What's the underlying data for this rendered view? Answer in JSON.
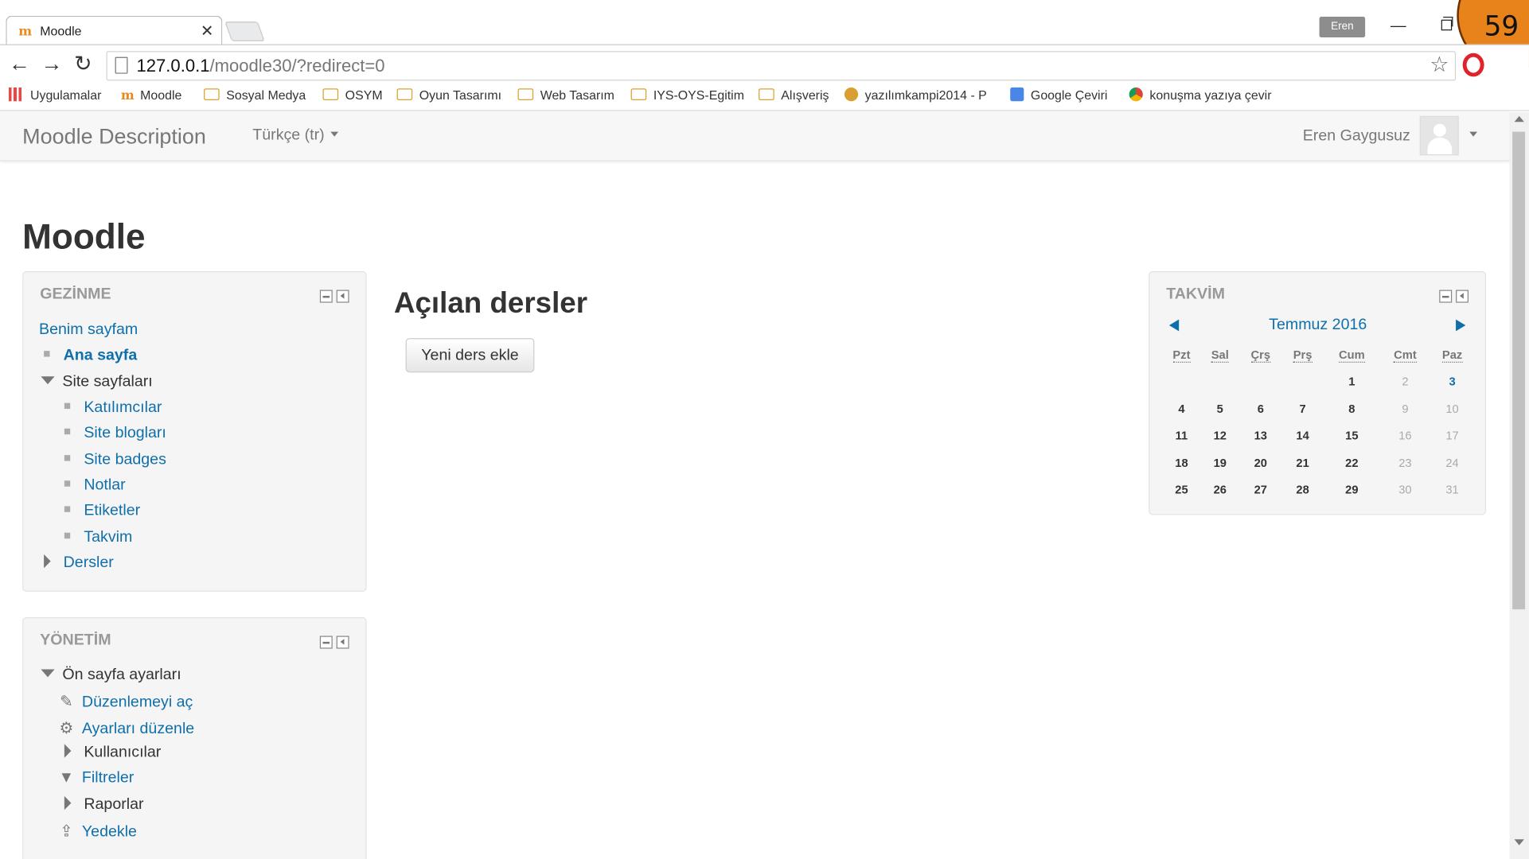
{
  "browser": {
    "tab_title": "Moodle",
    "tab_icon": "moodle-favicon",
    "profile_label": "Eren",
    "url_host": "127.0.0.1",
    "url_path": "/moodle30/?redirect=0",
    "overlay_number": "59",
    "bookmarks": [
      {
        "label": "Uygulamalar",
        "icon": "apps-grid-icon"
      },
      {
        "label": "Moodle",
        "icon": "moodle-icon"
      },
      {
        "label": "Sosyal Medya",
        "icon": "folder-icon"
      },
      {
        "label": "OSYM",
        "icon": "folder-icon"
      },
      {
        "label": "Oyun Tasarımı",
        "icon": "folder-icon"
      },
      {
        "label": "Web Tasarım",
        "icon": "folder-icon"
      },
      {
        "label": "IYS-OYS-Egitim",
        "icon": "folder-icon"
      },
      {
        "label": "Alışveriş",
        "icon": "folder-icon"
      },
      {
        "label": "yazılımkampi2014 - P",
        "icon": "leopard-icon"
      },
      {
        "label": "Google Çeviri",
        "icon": "google-translate-icon"
      },
      {
        "label": "konuşma yazıya çevir",
        "icon": "chrome-icon"
      }
    ]
  },
  "header": {
    "brand": "Moodle Description",
    "language": "Türkçe (tr)",
    "user_name": "Eren Gaygusuz"
  },
  "page": {
    "title": "Moodle",
    "main_heading": "Açılan dersler",
    "add_course_button": "Yeni ders ekle"
  },
  "navigation": {
    "title": "GEZİNME",
    "my_page": "Benim sayfam",
    "home": "Ana sayfa",
    "site_pages": "Site sayfaları",
    "site_pages_items": [
      "Katılımcılar",
      "Site blogları",
      "Site badges",
      "Notlar",
      "Etiketler",
      "Takvim"
    ],
    "courses": "Dersler"
  },
  "administration": {
    "title": "YÖNETİM",
    "front_page_settings": "Ön sayfa ayarları",
    "items": [
      {
        "label": "Düzenlemeyi aç",
        "icon": "pencil-icon",
        "kind": "link"
      },
      {
        "label": "Ayarları düzenle",
        "icon": "gear-icon",
        "kind": "link"
      },
      {
        "label": "Kullanıcılar",
        "icon": "chevron-right-icon",
        "kind": "branch"
      },
      {
        "label": "Filtreler",
        "icon": "filter-icon",
        "kind": "link"
      },
      {
        "label": "Raporlar",
        "icon": "chevron-right-icon",
        "kind": "branch"
      },
      {
        "label": "Yedekle",
        "icon": "backup-upload-icon",
        "kind": "link"
      }
    ]
  },
  "calendar": {
    "title": "TAKVİM",
    "month": "Temmuz 2016",
    "weekdays": [
      "Pzt",
      "Sal",
      "Çrş",
      "Prş",
      "Cum",
      "Cmt",
      "Paz"
    ],
    "weeks": [
      [
        "",
        "",
        "",
        "",
        "1",
        "2",
        "3"
      ],
      [
        "4",
        "5",
        "6",
        "7",
        "8",
        "9",
        "10"
      ],
      [
        "11",
        "12",
        "13",
        "14",
        "15",
        "16",
        "17"
      ],
      [
        "18",
        "19",
        "20",
        "21",
        "22",
        "23",
        "24"
      ],
      [
        "25",
        "26",
        "27",
        "28",
        "29",
        "30",
        "31"
      ]
    ],
    "today": "3"
  },
  "colors": {
    "link": "#0f6fab",
    "accent_badge": "#e8831c",
    "block_bg": "#f5f5f5"
  }
}
